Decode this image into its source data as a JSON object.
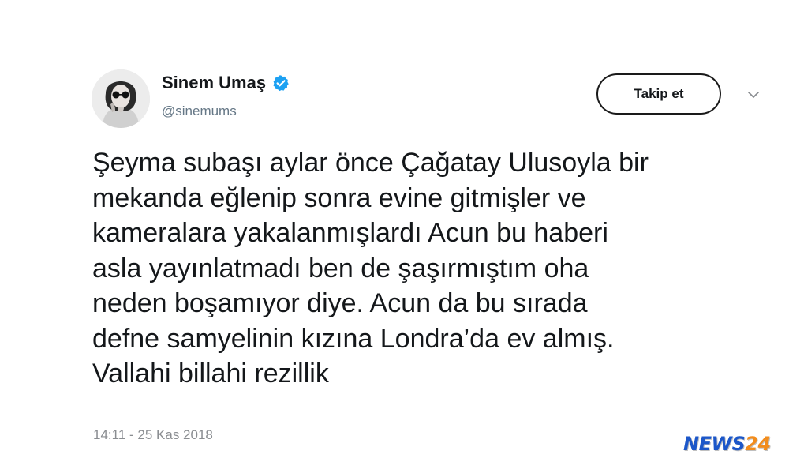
{
  "author": {
    "display_name": "Sinem Umaş",
    "handle": "@sinemums",
    "verified": true
  },
  "actions": {
    "follow_label": "Takip et"
  },
  "icons": {
    "verified": "verified-badge-icon",
    "more": "chevron-down-icon",
    "avatar": "avatar"
  },
  "tweet": {
    "lines": [
      "Şeyma subaşı aylar önce Çağatay Ulusoyla bir",
      "mekanda eğlenip sonra evine gitmişler ve",
      "kameralara yakalanmışlardı Acun bu haberi",
      "asla yayınlatmadı ben de şaşırmıştım oha",
      "neden boşamıyor diye. Acun da bu sırada",
      "defne samyelinin kızına Londra’da ev almış.",
      "Vallahi billahi rezillik"
    ],
    "timestamp": "14:11 - 25 Kas 2018"
  },
  "watermark": {
    "part1": "NEWS",
    "part2": "24"
  },
  "colors": {
    "verified_blue": "#1da1f2",
    "text": "#14171a",
    "muted": "#657786",
    "watermark_blue": "#1c57c9",
    "watermark_orange": "#f28c1c"
  }
}
